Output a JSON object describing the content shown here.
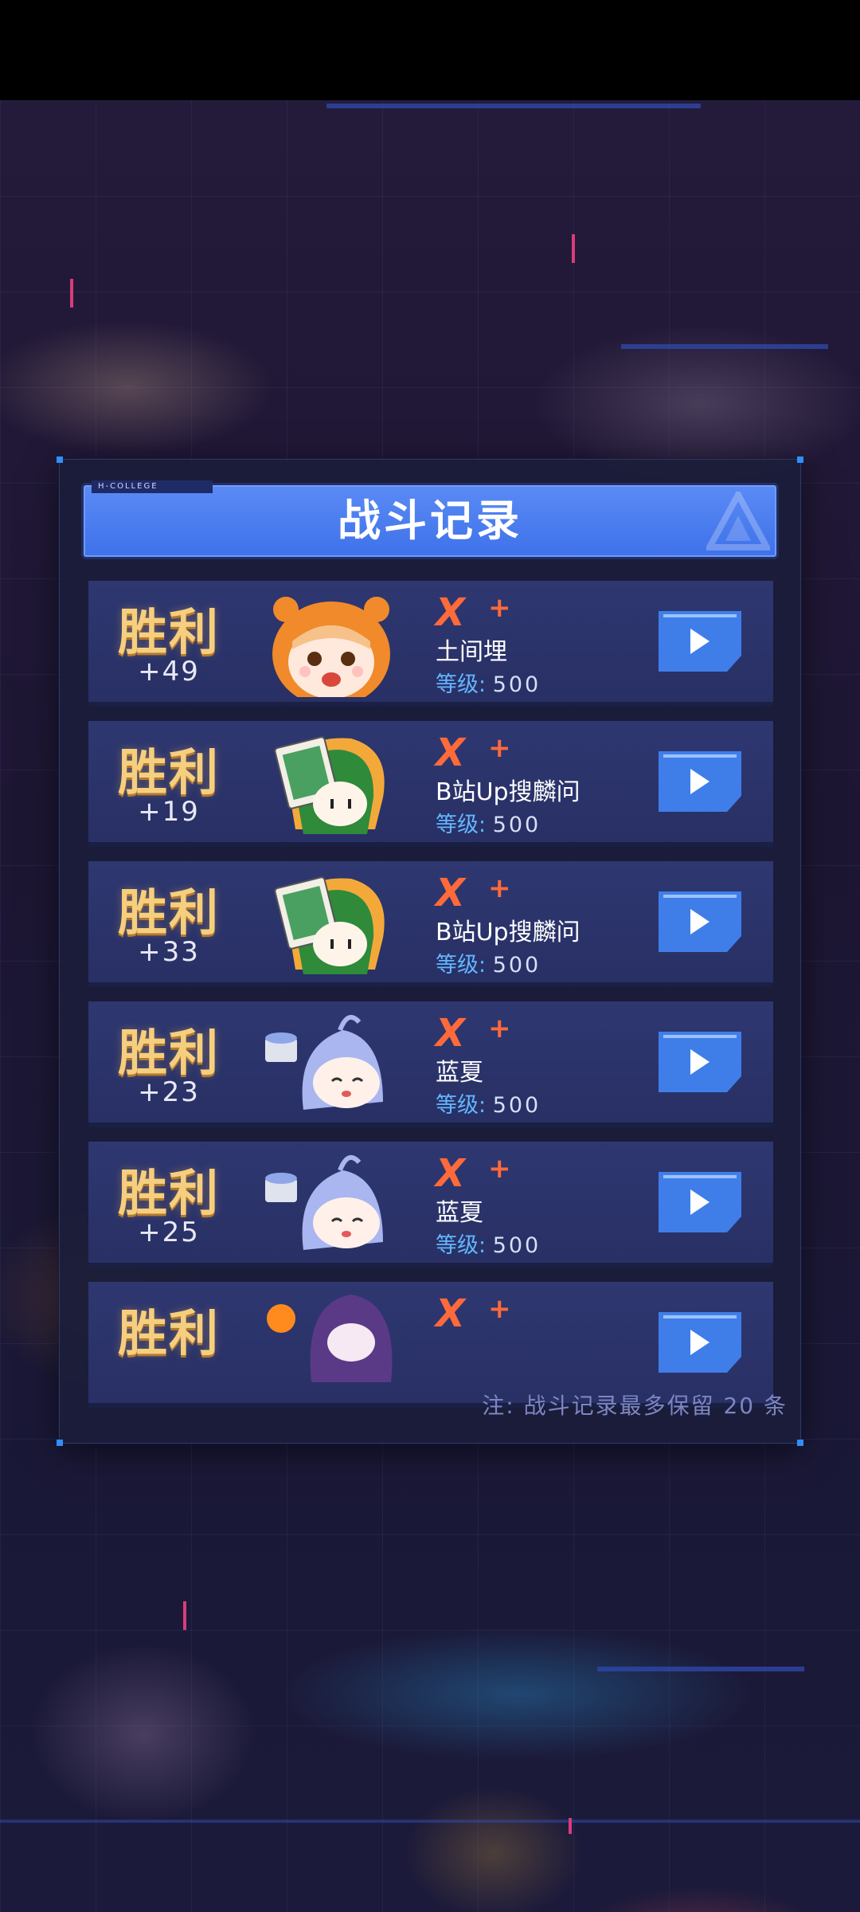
{
  "header": {
    "tag": "H-COLLEGE",
    "title": "战斗记录"
  },
  "records": [
    {
      "result": "胜利",
      "score": "+49",
      "rank": "X",
      "rank_plus": "+",
      "name": "土间埋",
      "level_label": "等级:",
      "level_value": "500",
      "avatar": "umaru-avatar-icon"
    },
    {
      "result": "胜利",
      "score": "+19",
      "rank": "X",
      "rank_plus": "+",
      "name": "B站Up搜麟问",
      "level_label": "等级:",
      "level_value": "500",
      "avatar": "green-hair-avatar-icon"
    },
    {
      "result": "胜利",
      "score": "+33",
      "rank": "X",
      "rank_plus": "+",
      "name": "B站Up搜麟问",
      "level_label": "等级:",
      "level_value": "500",
      "avatar": "green-hair-avatar-icon"
    },
    {
      "result": "胜利",
      "score": "+23",
      "rank": "X",
      "rank_plus": "+",
      "name": "蓝夏",
      "level_label": "等级:",
      "level_value": "500",
      "avatar": "blue-hair-avatar-icon"
    },
    {
      "result": "胜利",
      "score": "+25",
      "rank": "X",
      "rank_plus": "+",
      "name": "蓝夏",
      "level_label": "等级:",
      "level_value": "500",
      "avatar": "blue-hair-avatar-icon"
    },
    {
      "result": "胜利",
      "score": "",
      "rank": "X",
      "rank_plus": "+",
      "name": "",
      "level_label": "",
      "level_value": "",
      "avatar": "purple-hair-avatar-icon"
    }
  ],
  "footnote": "注: 战斗记录最多保留 20 条",
  "colors": {
    "header_blue": "#4a7cf0",
    "victory_gold": "#f6cf7e",
    "rank_orange": "#ff6a3a",
    "level_blue": "#63b6ff",
    "play_button": "#3f7ee8"
  }
}
